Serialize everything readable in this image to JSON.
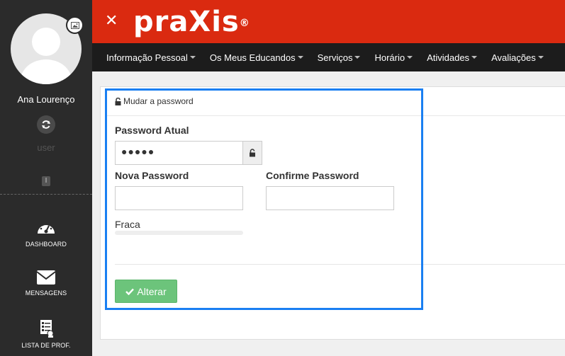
{
  "sidebar": {
    "user_name": "Ana Lourenço",
    "user_role": "user",
    "tag": "I",
    "items": [
      {
        "label": "DASHBOARD",
        "icon": "dashboard-icon"
      },
      {
        "label": "MENSAGENS",
        "icon": "envelope-icon"
      },
      {
        "label": "LISTA DE PROF.",
        "icon": "teacher-list-icon"
      }
    ]
  },
  "header": {
    "close": "✕",
    "logo": "praXis",
    "logo_mark": "®",
    "brand_color": "#da2a10"
  },
  "nav": {
    "items": [
      "Informação Pessoal",
      "Os Meus Educandos",
      "Serviços",
      "Horário",
      "Atividades",
      "Avaliações"
    ]
  },
  "form": {
    "title": "Mudar a password",
    "current_label": "Password Atual",
    "current_value": "●●●●●",
    "new_label": "Nova Password",
    "new_value": "",
    "confirm_label": "Confirme Password",
    "confirm_value": "",
    "strength_label": "Fraca",
    "strength_level": 0,
    "submit_label": "Alterar",
    "submit_color": "#6cc47b"
  }
}
